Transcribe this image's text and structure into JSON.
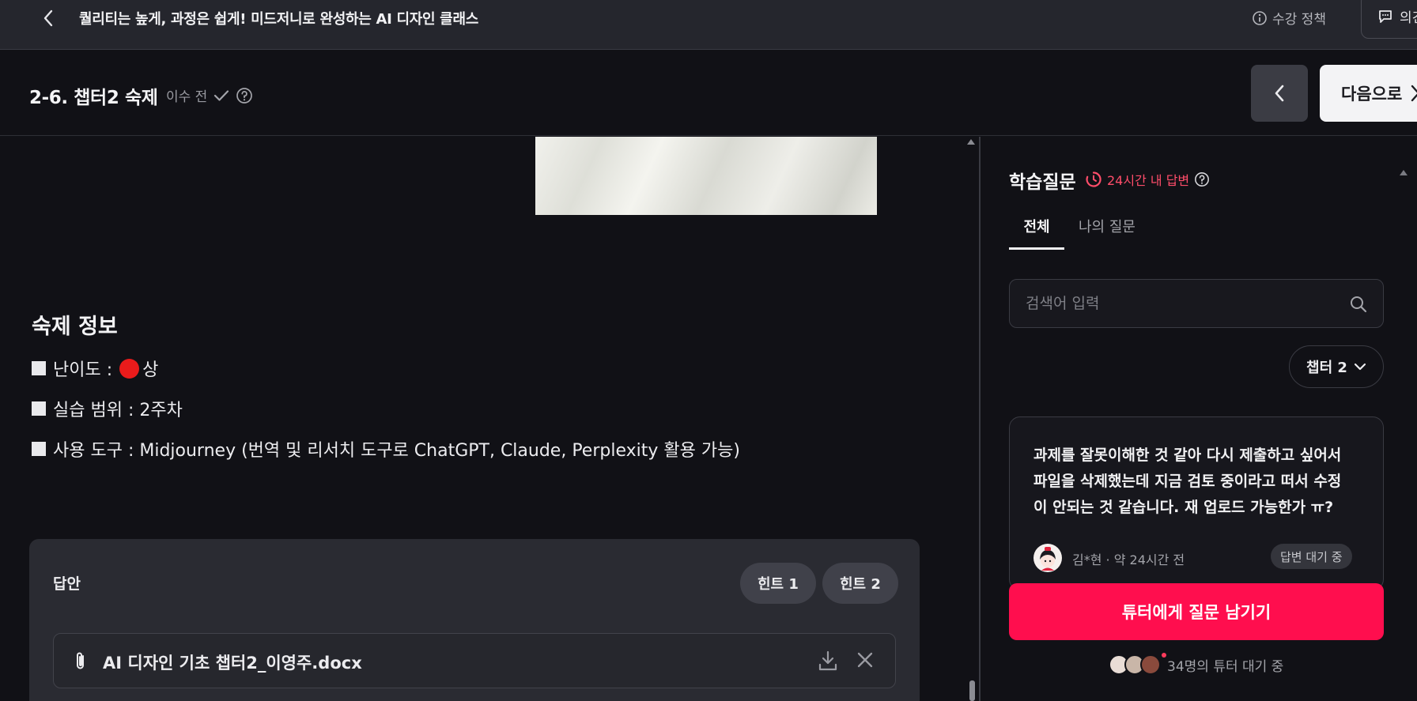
{
  "topbar": {
    "course_title": "퀄리티는 높게, 과정은 쉽게! 미드저니로 완성하는 AI 디자인 클래스",
    "policy_label": "수강 정책",
    "feedback_label": "의견"
  },
  "lesson": {
    "title": "2-6. 챕터2 숙제",
    "status": "이수 전",
    "next_label": "다음으로"
  },
  "homework": {
    "heading": "숙제 정보",
    "difficulty_label": "난이도 :",
    "difficulty_value": "상",
    "range": "실습 범위 : 2주차",
    "tools": "사용 도구 : Midjourney (번역 및 리서치 도구로 ChatGPT, Claude, Perplexity 활용 가능)",
    "difficulty_color": "#ea1b1b"
  },
  "answer": {
    "label": "답안",
    "hint1": "힌트 1",
    "hint2": "힌트 2",
    "file_name": "AI 디자인 기초 챕터2_이영주.docx"
  },
  "qa": {
    "title": "학습질문",
    "badge": "24시간 내 답변",
    "tabs": [
      "전체",
      "나의 질문"
    ],
    "search_placeholder": "검색어 입력",
    "chapter_filter": "챕터 2",
    "question": {
      "lines": [
        "과제를 잘못이해한 것 같아 다시 제출하고 싶어서",
        "파일을 삭제했는데 지금 검토 중이라고 떠서 수정",
        "이 안되는 것 같습니다. 재 업로드 가능한가 ㅠ?"
      ],
      "author": "김*현",
      "time": "약 24시간 전",
      "status": "답변 대기 중"
    },
    "ask_button": "튜터에게 질문 남기기",
    "waiting_text": "34명의 튜터 대기 중"
  },
  "colors": {
    "accent": "#ff0e4e",
    "badge": "#ff4d6a",
    "background": "#111116",
    "topbar": "#25262d"
  }
}
